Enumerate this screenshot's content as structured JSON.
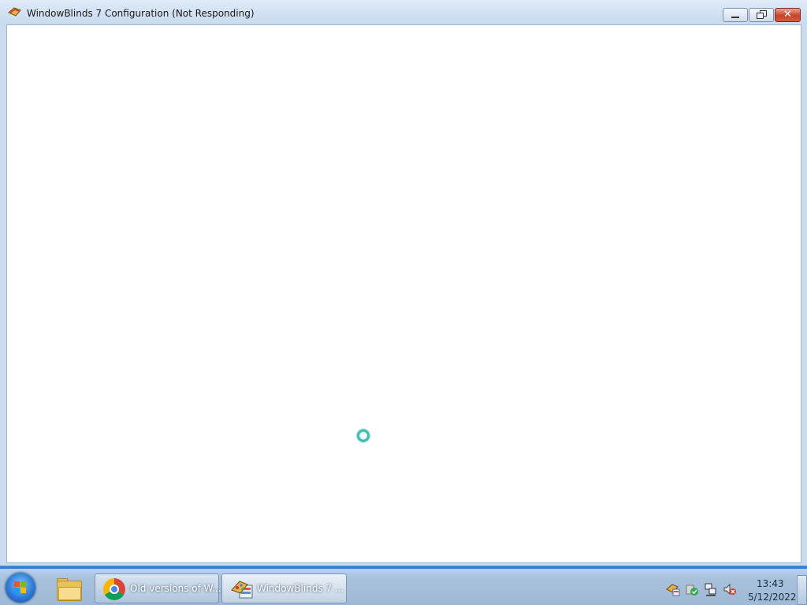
{
  "window": {
    "title": "WindowBlinds 7 Configuration (Not Responding)",
    "status": "Not Responding",
    "accent_color": "#c8412b"
  },
  "taskbar": {
    "items": [
      {
        "label": "Old versions of W...",
        "icon": "chrome-icon"
      },
      {
        "label": "WindowBlinds 7 ...",
        "icon": "windowblinds-icon"
      }
    ],
    "pinned": [
      {
        "icon": "file-explorer-icon"
      }
    ],
    "tray": {
      "icons": [
        "windowblinds-tray-icon",
        "security-check-icon",
        "network-icon",
        "volume-muted-icon"
      ],
      "time": "13:43",
      "date": "5/12/2022"
    }
  }
}
